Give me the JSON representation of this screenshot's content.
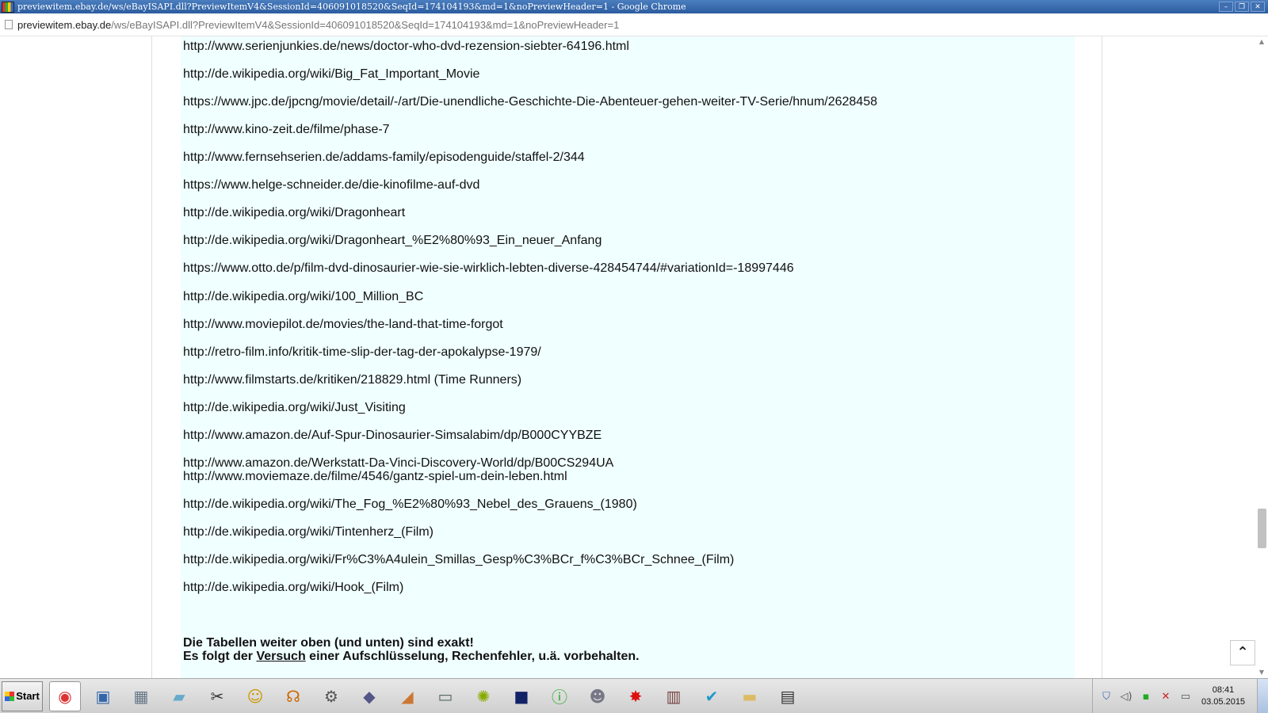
{
  "window": {
    "title": "previewitem.ebay.de/ws/eBayISAPI.dll?PreviewItemV4&SessionId=406091018520&SeqId=174104193&md=1&noPreviewHeader=1 - Google Chrome",
    "minimize": "–",
    "maximize": "❐",
    "close": "✕"
  },
  "address": {
    "domain": "previewitem.ebay.de",
    "path": "/ws/eBayISAPI.dll?PreviewItemV4&SessionId=406091018520&SeqId=174104193&md=1&noPreviewHeader=1"
  },
  "links": [
    "http://www.serienjunkies.de/news/doctor-who-dvd-rezension-siebter-64196.html",
    "http://de.wikipedia.org/wiki/Big_Fat_Important_Movie",
    "https://www.jpc.de/jpcng/movie/detail/-/art/Die-unendliche-Geschichte-Die-Abenteuer-gehen-weiter-TV-Serie/hnum/2628458",
    "http://www.kino-zeit.de/filme/phase-7",
    "http://www.fernsehserien.de/addams-family/episodenguide/staffel-2/344",
    "https://www.helge-schneider.de/die-kinofilme-auf-dvd",
    "http://de.wikipedia.org/wiki/Dragonheart",
    "http://de.wikipedia.org/wiki/Dragonheart_%E2%80%93_Ein_neuer_Anfang",
    "https://www.otto.de/p/film-dvd-dinosaurier-wie-sie-wirklich-lebten-diverse-428454744/#variationId=-18997446",
    "http://de.wikipedia.org/wiki/100_Million_BC",
    "http://www.moviepilot.de/movies/the-land-that-time-forgot",
    "http://retro-film.info/kritik-time-slip-der-tag-der-apokalypse-1979/",
    "http://www.filmstarts.de/kritiken/218829.html (Time Runners)",
    "http://de.wikipedia.org/wiki/Just_Visiting",
    "http://www.amazon.de/Auf-Spur-Dinosaurier-Simsalabim/dp/B000CYYBZE",
    "http://www.amazon.de/Werkstatt-Da-Vinci-Discovery-World/dp/B00CS294UA",
    "http://www.moviemaze.de/filme/4546/gantz-spiel-um-dein-leben.html",
    "http://de.wikipedia.org/wiki/The_Fog_%E2%80%93_Nebel_des_Grauens_(1980)",
    "http://de.wikipedia.org/wiki/Tintenherz_(Film)",
    "http://de.wikipedia.org/wiki/Fr%C3%A4ulein_Smillas_Gesp%C3%BCr_f%C3%BCr_Schnee_(Film)",
    "http://de.wikipedia.org/wiki/Hook_(Film)"
  ],
  "notes": {
    "line1": "Die Tabellen weiter oben (und unten) sind exakt!",
    "line2_prefix": "Es folgt der ",
    "line2_link": "Versuch",
    "line2_suffix": " einer Aufschlüsselung, Rechenfehler, u.ä. vorbehalten."
  },
  "scroll_to_top": "⌃",
  "taskbar": {
    "start_label": "Start",
    "apps": [
      {
        "name": "chrome-icon",
        "glyph": "◉",
        "color": "#d33"
      },
      {
        "name": "image-viewer-icon",
        "glyph": "▣",
        "color": "#36a"
      },
      {
        "name": "calculator-icon",
        "glyph": "▦",
        "color": "#678"
      },
      {
        "name": "notebook-icon",
        "glyph": "▰",
        "color": "#6ac"
      },
      {
        "name": "scissors-icon",
        "glyph": "✂",
        "color": "#333"
      },
      {
        "name": "smiley-icon",
        "glyph": "☺",
        "color": "#c90"
      },
      {
        "name": "headphones-icon",
        "glyph": "☊",
        "color": "#c60"
      },
      {
        "name": "settings-icon",
        "glyph": "⚙",
        "color": "#555"
      },
      {
        "name": "graduation-icon",
        "glyph": "◆",
        "color": "#558"
      },
      {
        "name": "puzzle-icon",
        "glyph": "◢",
        "color": "#c73"
      },
      {
        "name": "window-icon",
        "glyph": "▭",
        "color": "#566"
      },
      {
        "name": "shell-icon",
        "glyph": "✺",
        "color": "#8a0"
      },
      {
        "name": "kindle-icon",
        "glyph": "■",
        "color": "#126"
      },
      {
        "name": "info-icon",
        "glyph": "ⓘ",
        "color": "#2a2"
      },
      {
        "name": "user-icon",
        "glyph": "☻",
        "color": "#778"
      },
      {
        "name": "splat-icon",
        "glyph": "✸",
        "color": "#d11"
      },
      {
        "name": "books-icon",
        "glyph": "▥",
        "color": "#744"
      },
      {
        "name": "twitter-icon",
        "glyph": "✔",
        "color": "#29c"
      },
      {
        "name": "folder-icon",
        "glyph": "▬",
        "color": "#db6"
      },
      {
        "name": "notepad-icon",
        "glyph": "▤",
        "color": "#333"
      }
    ],
    "tray": {
      "clock_time": "08:41",
      "clock_date": "03.05.2015"
    }
  },
  "colors": {
    "content_background": "#f0ffff",
    "title_bar": "#2c5c9f"
  }
}
